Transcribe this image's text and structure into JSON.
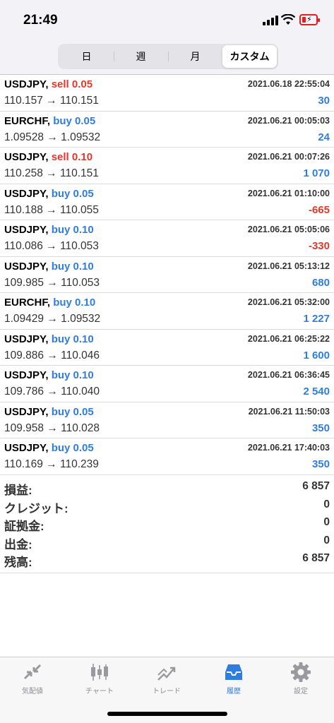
{
  "status": {
    "time": "21:49"
  },
  "period_tabs": [
    "日",
    "週",
    "月",
    "カスタム"
  ],
  "active_tab": "カスタム",
  "deals": [
    {
      "symbol": "USDJPY,",
      "side": "sell 0.05",
      "side_type": "sell",
      "prices": "110.157 → 110.151",
      "time": "2021.06.18 22:55:04",
      "profit": "30",
      "profit_sign": "pos"
    },
    {
      "symbol": "EURCHF,",
      "side": "buy 0.05",
      "side_type": "buy",
      "prices": "1.09528 → 1.09532",
      "time": "2021.06.21 00:05:03",
      "profit": "24",
      "profit_sign": "pos"
    },
    {
      "symbol": "USDJPY,",
      "side": "sell 0.10",
      "side_type": "sell",
      "prices": "110.258 → 110.151",
      "time": "2021.06.21 00:07:26",
      "profit": "1 070",
      "profit_sign": "pos"
    },
    {
      "symbol": "USDJPY,",
      "side": "buy 0.05",
      "side_type": "buy",
      "prices": "110.188 → 110.055",
      "time": "2021.06.21 01:10:00",
      "profit": "-665",
      "profit_sign": "neg"
    },
    {
      "symbol": "USDJPY,",
      "side": "buy 0.10",
      "side_type": "buy",
      "prices": "110.086 → 110.053",
      "time": "2021.06.21 05:05:06",
      "profit": "-330",
      "profit_sign": "neg"
    },
    {
      "symbol": "USDJPY,",
      "side": "buy 0.10",
      "side_type": "buy",
      "prices": "109.985 → 110.053",
      "time": "2021.06.21 05:13:12",
      "profit": "680",
      "profit_sign": "pos"
    },
    {
      "symbol": "EURCHF,",
      "side": "buy 0.10",
      "side_type": "buy",
      "prices": "1.09429 → 1.09532",
      "time": "2021.06.21 05:32:00",
      "profit": "1 227",
      "profit_sign": "pos"
    },
    {
      "symbol": "USDJPY,",
      "side": "buy 0.10",
      "side_type": "buy",
      "prices": "109.886 → 110.046",
      "time": "2021.06.21 06:25:22",
      "profit": "1 600",
      "profit_sign": "pos"
    },
    {
      "symbol": "USDJPY,",
      "side": "buy 0.10",
      "side_type": "buy",
      "prices": "109.786 → 110.040",
      "time": "2021.06.21 06:36:45",
      "profit": "2 540",
      "profit_sign": "pos"
    },
    {
      "symbol": "USDJPY,",
      "side": "buy 0.05",
      "side_type": "buy",
      "prices": "109.958 → 110.028",
      "time": "2021.06.21 11:50:03",
      "profit": "350",
      "profit_sign": "pos"
    },
    {
      "symbol": "USDJPY,",
      "side": "buy 0.05",
      "side_type": "buy",
      "prices": "110.169 → 110.239",
      "time": "2021.06.21 17:40:03",
      "profit": "350",
      "profit_sign": "pos"
    }
  ],
  "summary": [
    {
      "label": "損益:",
      "value": "6 857"
    },
    {
      "label": "クレジット:",
      "value": "0"
    },
    {
      "label": "証拠金:",
      "value": "0"
    },
    {
      "label": "出金:",
      "value": "0"
    },
    {
      "label": "残高:",
      "value": "6 857"
    }
  ],
  "tabbar": [
    {
      "label": "気配値",
      "icon": "quotes-icon"
    },
    {
      "label": "チャート",
      "icon": "chart-icon"
    },
    {
      "label": "トレード",
      "icon": "trade-icon"
    },
    {
      "label": "履歴",
      "icon": "history-icon",
      "active": true
    },
    {
      "label": "設定",
      "icon": "settings-icon"
    }
  ],
  "colors": {
    "buy": "#2f7de1",
    "sell": "#e0382b",
    "active_tab": "#2f7de1"
  }
}
